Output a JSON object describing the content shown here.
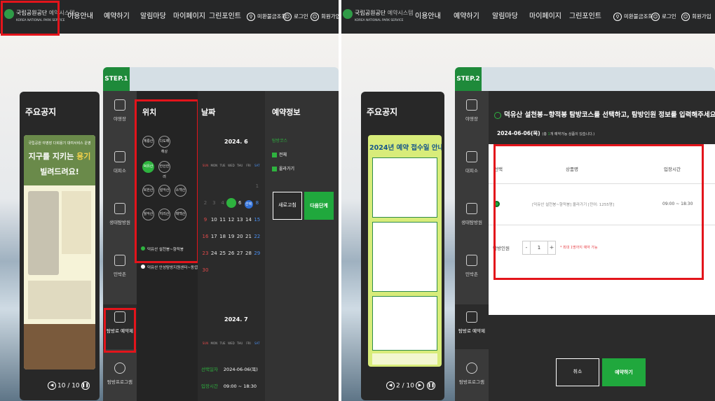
{
  "header": {
    "logo_title": "국립공원공단",
    "logo_system": "예약시스템",
    "logo_sub": "KOREA NATIONAL PARK SERVICE",
    "nav": [
      "이용안내",
      "예약하기",
      "알림마당",
      "마이페이지",
      "그린포인트"
    ],
    "util": [
      "미환불금조회",
      "로그인",
      "회원가입"
    ]
  },
  "left": {
    "notice_title": "주요공지",
    "poster": {
      "top": "국립공원 야영장 다회용기 대여서비스 운영",
      "headline1": "지구를 지키는",
      "headline1_highlight": "용기",
      "headline2": "빌려드려요!"
    },
    "pager": "10 / 10",
    "step_label": "STEP.1",
    "side_menu": [
      "야영장",
      "대피소",
      "생태탐방원",
      "민박촌",
      "탐방로 예약제",
      "탐방프로그램"
    ],
    "location_title": "위치",
    "parks": [
      "계룡산",
      "다도해해상",
      "덕유산",
      "한산한려",
      "북한산",
      "설악산",
      "소백산",
      "월악산",
      "지리산",
      "태백산"
    ],
    "selected_park": "덕유산",
    "routes": [
      {
        "label": "덕유산 설천봉~향적봉",
        "selected": true
      },
      {
        "label": "덕유산 안성탐방지원센터~동엽령",
        "selected": false
      }
    ],
    "date_title": "날짜",
    "month1": "2024. 6",
    "month2": "2024. 7",
    "weekdays": [
      "SUN",
      "MON",
      "TUE",
      "WED",
      "THU",
      "FRI",
      "SAT"
    ],
    "selected_label": "선택일자",
    "selected_value": "2024-06-06(목)",
    "time_label": "입장시간",
    "time_value": "09:00 ~ 18:30",
    "reservation_title": "예약정보",
    "reservation_course_label": "탐방코스",
    "reservation_options": [
      "전체",
      "올라가기"
    ],
    "refresh_button": "새로고침",
    "next_button": "다음단계"
  },
  "right": {
    "notice_title": "주요공지",
    "poster_title": "2024년 예약 접수일 안내",
    "pager": "2 / 10",
    "step_label": "STEP.2",
    "side_menu": [
      "야영장",
      "대피소",
      "생태탐방원",
      "민박촌",
      "탐방로 예약제",
      "탐방프로그램"
    ],
    "heading": "덕유산 설천봉~향적봉 탐방코스를 선택하고, 탐방인원 정보를 입력해주세요.",
    "date_line": "2024-06-06(목)",
    "date_note_pre": "총",
    "date_note_count": "1",
    "date_note_post": "개 예약가능 상품이 있습니다.",
    "columns": [
      "선택",
      "상품명",
      "입장시간"
    ],
    "row": {
      "name": "[덕유산 설천봉~향적봉] 올라가기 [잔여: 1255명]",
      "time": "09:00 ~ 18:30"
    },
    "people_label": "탐방인원",
    "quantity": "1",
    "minus": "-",
    "plus": "+",
    "people_note": "* 최대 1명까지 예약 가능",
    "cancel_button": "취소",
    "reserve_button": "예약하기"
  }
}
